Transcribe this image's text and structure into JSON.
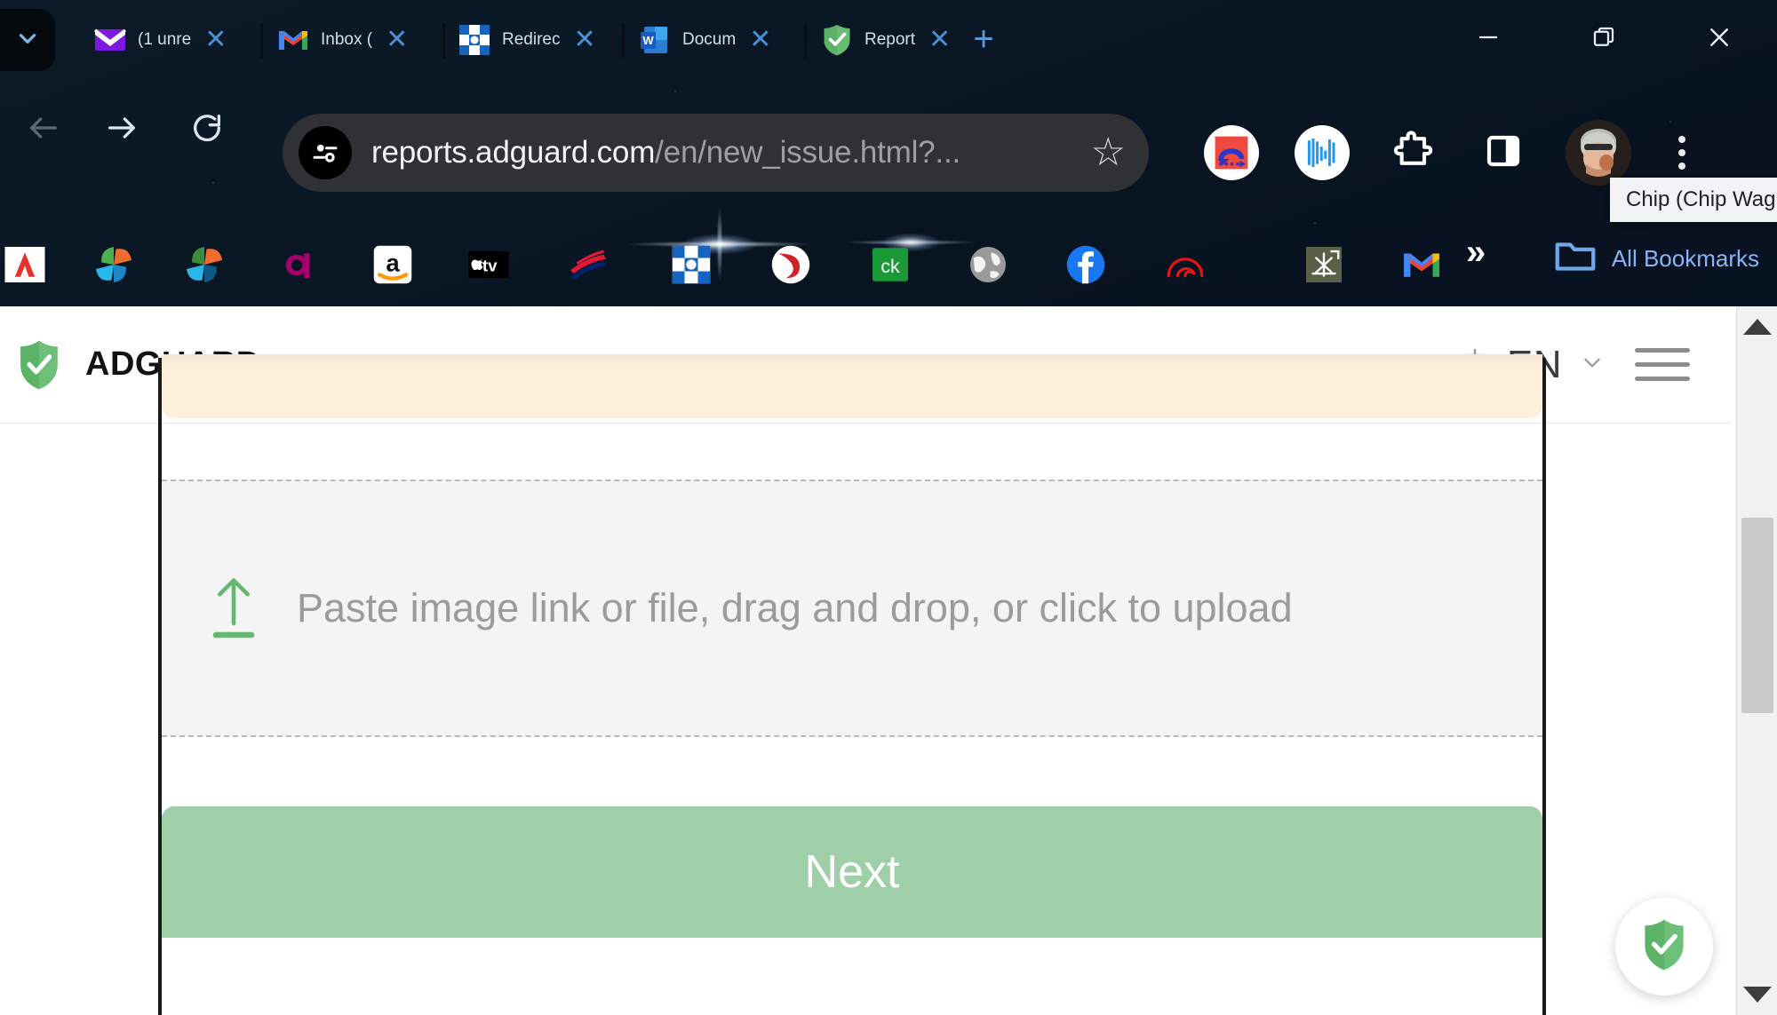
{
  "browser": {
    "tab_list_icon": "chevron-down-icon",
    "tabs": [
      {
        "title": "(1 unre",
        "favicon": "mail-purple-icon",
        "close_label": "✕"
      },
      {
        "title": "Inbox (",
        "favicon": "gmail-icon",
        "close_label": "✕"
      },
      {
        "title": "Redirec",
        "favicon": "blue-checkered-icon",
        "close_label": "✕"
      },
      {
        "title": "Docum",
        "favicon": "word-icon",
        "close_label": "✕"
      },
      {
        "title": "Report",
        "favicon": "adguard-shield-icon",
        "close_label": "✕"
      }
    ],
    "new_tab_label": "+",
    "window_controls": {
      "minimize": "minimize-icon",
      "restore": "restore-icon",
      "close": "close-icon"
    },
    "nav": {
      "back": "back-arrow-icon",
      "forward": "forward-arrow-icon",
      "reload": "reload-icon"
    },
    "omnibox": {
      "site_info_icon": "site-settings-icon",
      "url_host": "reports.adguard.com",
      "url_path": "/en/new_issue.html?...",
      "bookmark_star": "☆"
    },
    "extensions": [
      {
        "name": "redirect-extension-icon"
      },
      {
        "name": "audio-waveform-extension-icon"
      },
      {
        "name": "extensions-puzzle-icon"
      },
      {
        "name": "side-panel-icon"
      }
    ],
    "profile": {
      "avatar_name": "profile-avatar",
      "tooltip": "Chip (Chip Wagner)"
    },
    "menu_icon": "chrome-menu-kebab-icon",
    "bookmarks": [
      {
        "name": "bookmark-adobe"
      },
      {
        "name": "bookmark-pinwheel-1"
      },
      {
        "name": "bookmark-pinwheel-2"
      },
      {
        "name": "bookmark-magenta-a"
      },
      {
        "name": "bookmark-amazon"
      },
      {
        "name": "bookmark-apple-tv"
      },
      {
        "name": "bookmark-bank-of-america"
      },
      {
        "name": "bookmark-blue-checkered"
      },
      {
        "name": "bookmark-red-swirl"
      },
      {
        "name": "bookmark-ck"
      },
      {
        "name": "bookmark-globe"
      },
      {
        "name": "bookmark-facebook"
      },
      {
        "name": "bookmark-red-arc"
      },
      {
        "name": "bookmark-olive-spark"
      },
      {
        "name": "bookmark-gmail"
      }
    ],
    "bookmarks_overflow_label": "»",
    "all_bookmarks_label": "All Bookmarks",
    "all_bookmarks_icon": "folder-icon"
  },
  "site": {
    "brand_name": "ADGUARD",
    "brand_icon": "adguard-shield-icon",
    "language": {
      "icon": "translate-icon",
      "code": "EN",
      "chevron": "∨"
    },
    "menu_icon": "hamburger-menu-icon",
    "banner": {
      "color": "#fdefdb"
    },
    "dropzone": {
      "icon": "upload-arrow-icon",
      "text": "Paste image link or file, drag and drop, or click to upload"
    },
    "next_button": {
      "label": "Next",
      "color": "#9ecfa8"
    },
    "assistant_icon": "adguard-shield-icon",
    "scrollbar": {
      "up": "scroll-up-arrow",
      "down": "scroll-down-arrow",
      "thumb": "scroll-thumb"
    }
  },
  "colors": {
    "adguard_green": "#68bc71",
    "next_green": "#9ecfa8",
    "banner_cream": "#fdefdb",
    "omnibox_bg": "#303134",
    "link_blue": "#8ab4f8"
  }
}
